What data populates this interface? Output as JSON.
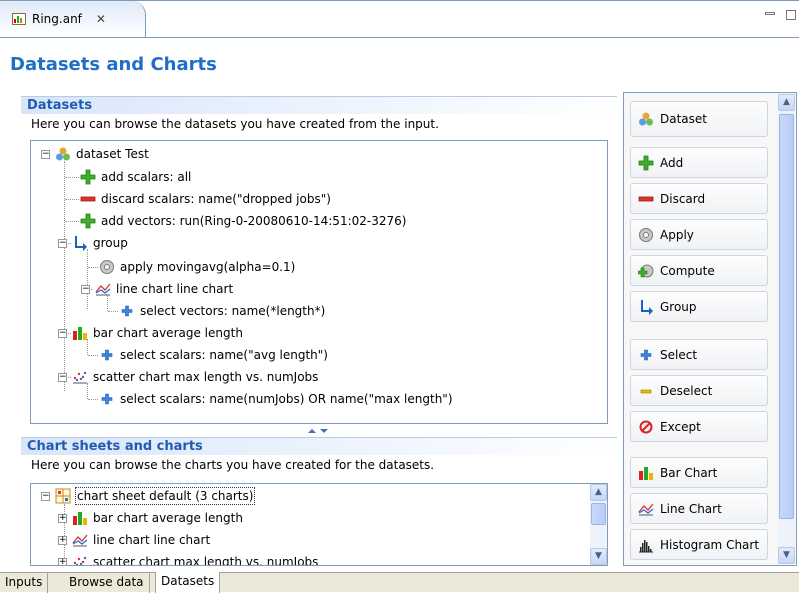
{
  "editor": {
    "tab_title": "Ring.anf",
    "close_glyph": "✕"
  },
  "page": {
    "title": "Datasets and Charts"
  },
  "datasets": {
    "header": "Datasets",
    "description": "Here you can browse the datasets you have created from the input.",
    "tree": [
      {
        "label": "dataset Test",
        "icon": "dataset-icon",
        "expander": "−"
      },
      {
        "label": "add scalars: all",
        "icon": "add-icon"
      },
      {
        "label": "discard scalars: name(\"dropped jobs\")",
        "icon": "discard-icon"
      },
      {
        "label": "add vectors: run(Ring-0-20080610-14:51:02-3276)",
        "icon": "add-icon"
      },
      {
        "label": "group",
        "icon": "group-icon",
        "expander": "−"
      },
      {
        "label": "apply movingavg(alpha=0.1)",
        "icon": "apply-icon"
      },
      {
        "label": "line chart line chart",
        "icon": "line-chart-icon",
        "expander": "−"
      },
      {
        "label": "select vectors: name(*length*)",
        "icon": "select-icon"
      },
      {
        "label": "bar chart average length",
        "icon": "bar-chart-icon",
        "expander": "−"
      },
      {
        "label": "select scalars: name(\"avg length\")",
        "icon": "select-icon"
      },
      {
        "label": "scatter chart max length vs. numJobs",
        "icon": "scatter-chart-icon",
        "expander": "−"
      },
      {
        "label": "select scalars: name(numJobs) OR name(\"max length\")",
        "icon": "select-icon"
      }
    ]
  },
  "charts": {
    "header": "Chart sheets and charts",
    "description": "Here you can browse the charts you have created for the datasets.",
    "tree": [
      {
        "label": "chart sheet default (3 charts)",
        "icon": "chart-sheet-icon",
        "expander": "−"
      },
      {
        "label": "bar chart average length",
        "icon": "bar-chart-icon",
        "expander": "+"
      },
      {
        "label": "line chart line chart",
        "icon": "line-chart-icon",
        "expander": "+"
      },
      {
        "label": "scatter chart max length vs. numJobs",
        "icon": "scatter-chart-icon",
        "expander": "+"
      }
    ]
  },
  "toolbar": {
    "buttons": [
      {
        "label": "Dataset",
        "icon": "dataset-icon"
      },
      {
        "label": "Add",
        "icon": "add-icon"
      },
      {
        "label": "Discard",
        "icon": "discard-icon"
      },
      {
        "label": "Apply",
        "icon": "apply-icon"
      },
      {
        "label": "Compute",
        "icon": "compute-icon"
      },
      {
        "label": "Group",
        "icon": "group-icon"
      },
      {
        "label": "Select",
        "icon": "select-icon"
      },
      {
        "label": "Deselect",
        "icon": "deselect-icon"
      },
      {
        "label": "Except",
        "icon": "except-icon"
      },
      {
        "label": "Bar Chart",
        "icon": "bar-chart-icon"
      },
      {
        "label": "Line Chart",
        "icon": "line-chart-icon"
      },
      {
        "label": "Histogram Chart",
        "icon": "histogram-chart-icon"
      }
    ]
  },
  "bottom_tabs": [
    {
      "label": "Inputs",
      "active": false
    },
    {
      "label": "Browse data",
      "active": false
    },
    {
      "label": "Datasets",
      "active": true
    }
  ]
}
